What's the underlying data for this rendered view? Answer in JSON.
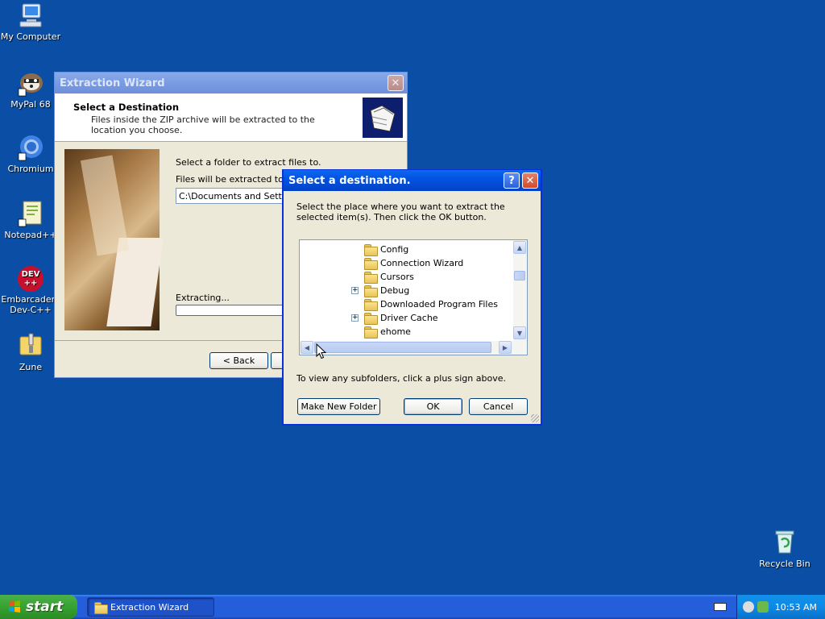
{
  "desktop": {
    "icons": [
      {
        "label": "My Computer",
        "icon": "my-computer-icon"
      },
      {
        "label": "MyPal 68",
        "icon": "mypal-icon"
      },
      {
        "label": "Chromium",
        "icon": "chromium-icon"
      },
      {
        "label": "Notepad++",
        "icon": "notepadpp-icon"
      },
      {
        "label": "Embarcadero Dev-C++",
        "icon": "devcpp-icon",
        "badge": "DEV",
        "badge2": "++"
      },
      {
        "label": "Zune",
        "icon": "zune-icon"
      },
      {
        "label": "Recycle Bin",
        "icon": "recycle-bin-icon"
      }
    ]
  },
  "wizard": {
    "title": "Extraction Wizard",
    "header_title": "Select a Destination",
    "header_sub": "Files inside the ZIP archive will be extracted to the location you choose.",
    "select_label": "Select a folder to extract files to.",
    "extract_to_label": "Files will be extracted to this",
    "path_value": "C:\\Documents and Settings",
    "extracting_label": "Extracting...",
    "back_button": "< Back"
  },
  "browse_dialog": {
    "title": "Select a destination.",
    "help_glyph": "?",
    "close_glyph": "✕",
    "instructions": "Select the place where you want to extract the selected item(s).  Then click the OK button.",
    "tree_items": [
      {
        "label": "Config",
        "expandable": false
      },
      {
        "label": "Connection Wizard",
        "expandable": false
      },
      {
        "label": "Cursors",
        "expandable": false
      },
      {
        "label": "Debug",
        "expandable": true
      },
      {
        "label": "Downloaded Program Files",
        "expandable": false
      },
      {
        "label": "Driver Cache",
        "expandable": true
      },
      {
        "label": "ehome",
        "expandable": false
      }
    ],
    "hint": "To view any subfolders, click a plus sign above.",
    "make_folder_button": "Make New Folder",
    "ok_button": "OK",
    "cancel_button": "Cancel"
  },
  "taskbar": {
    "start_label": "start",
    "task_item": "Extraction Wizard",
    "clock": "10:53 AM"
  }
}
